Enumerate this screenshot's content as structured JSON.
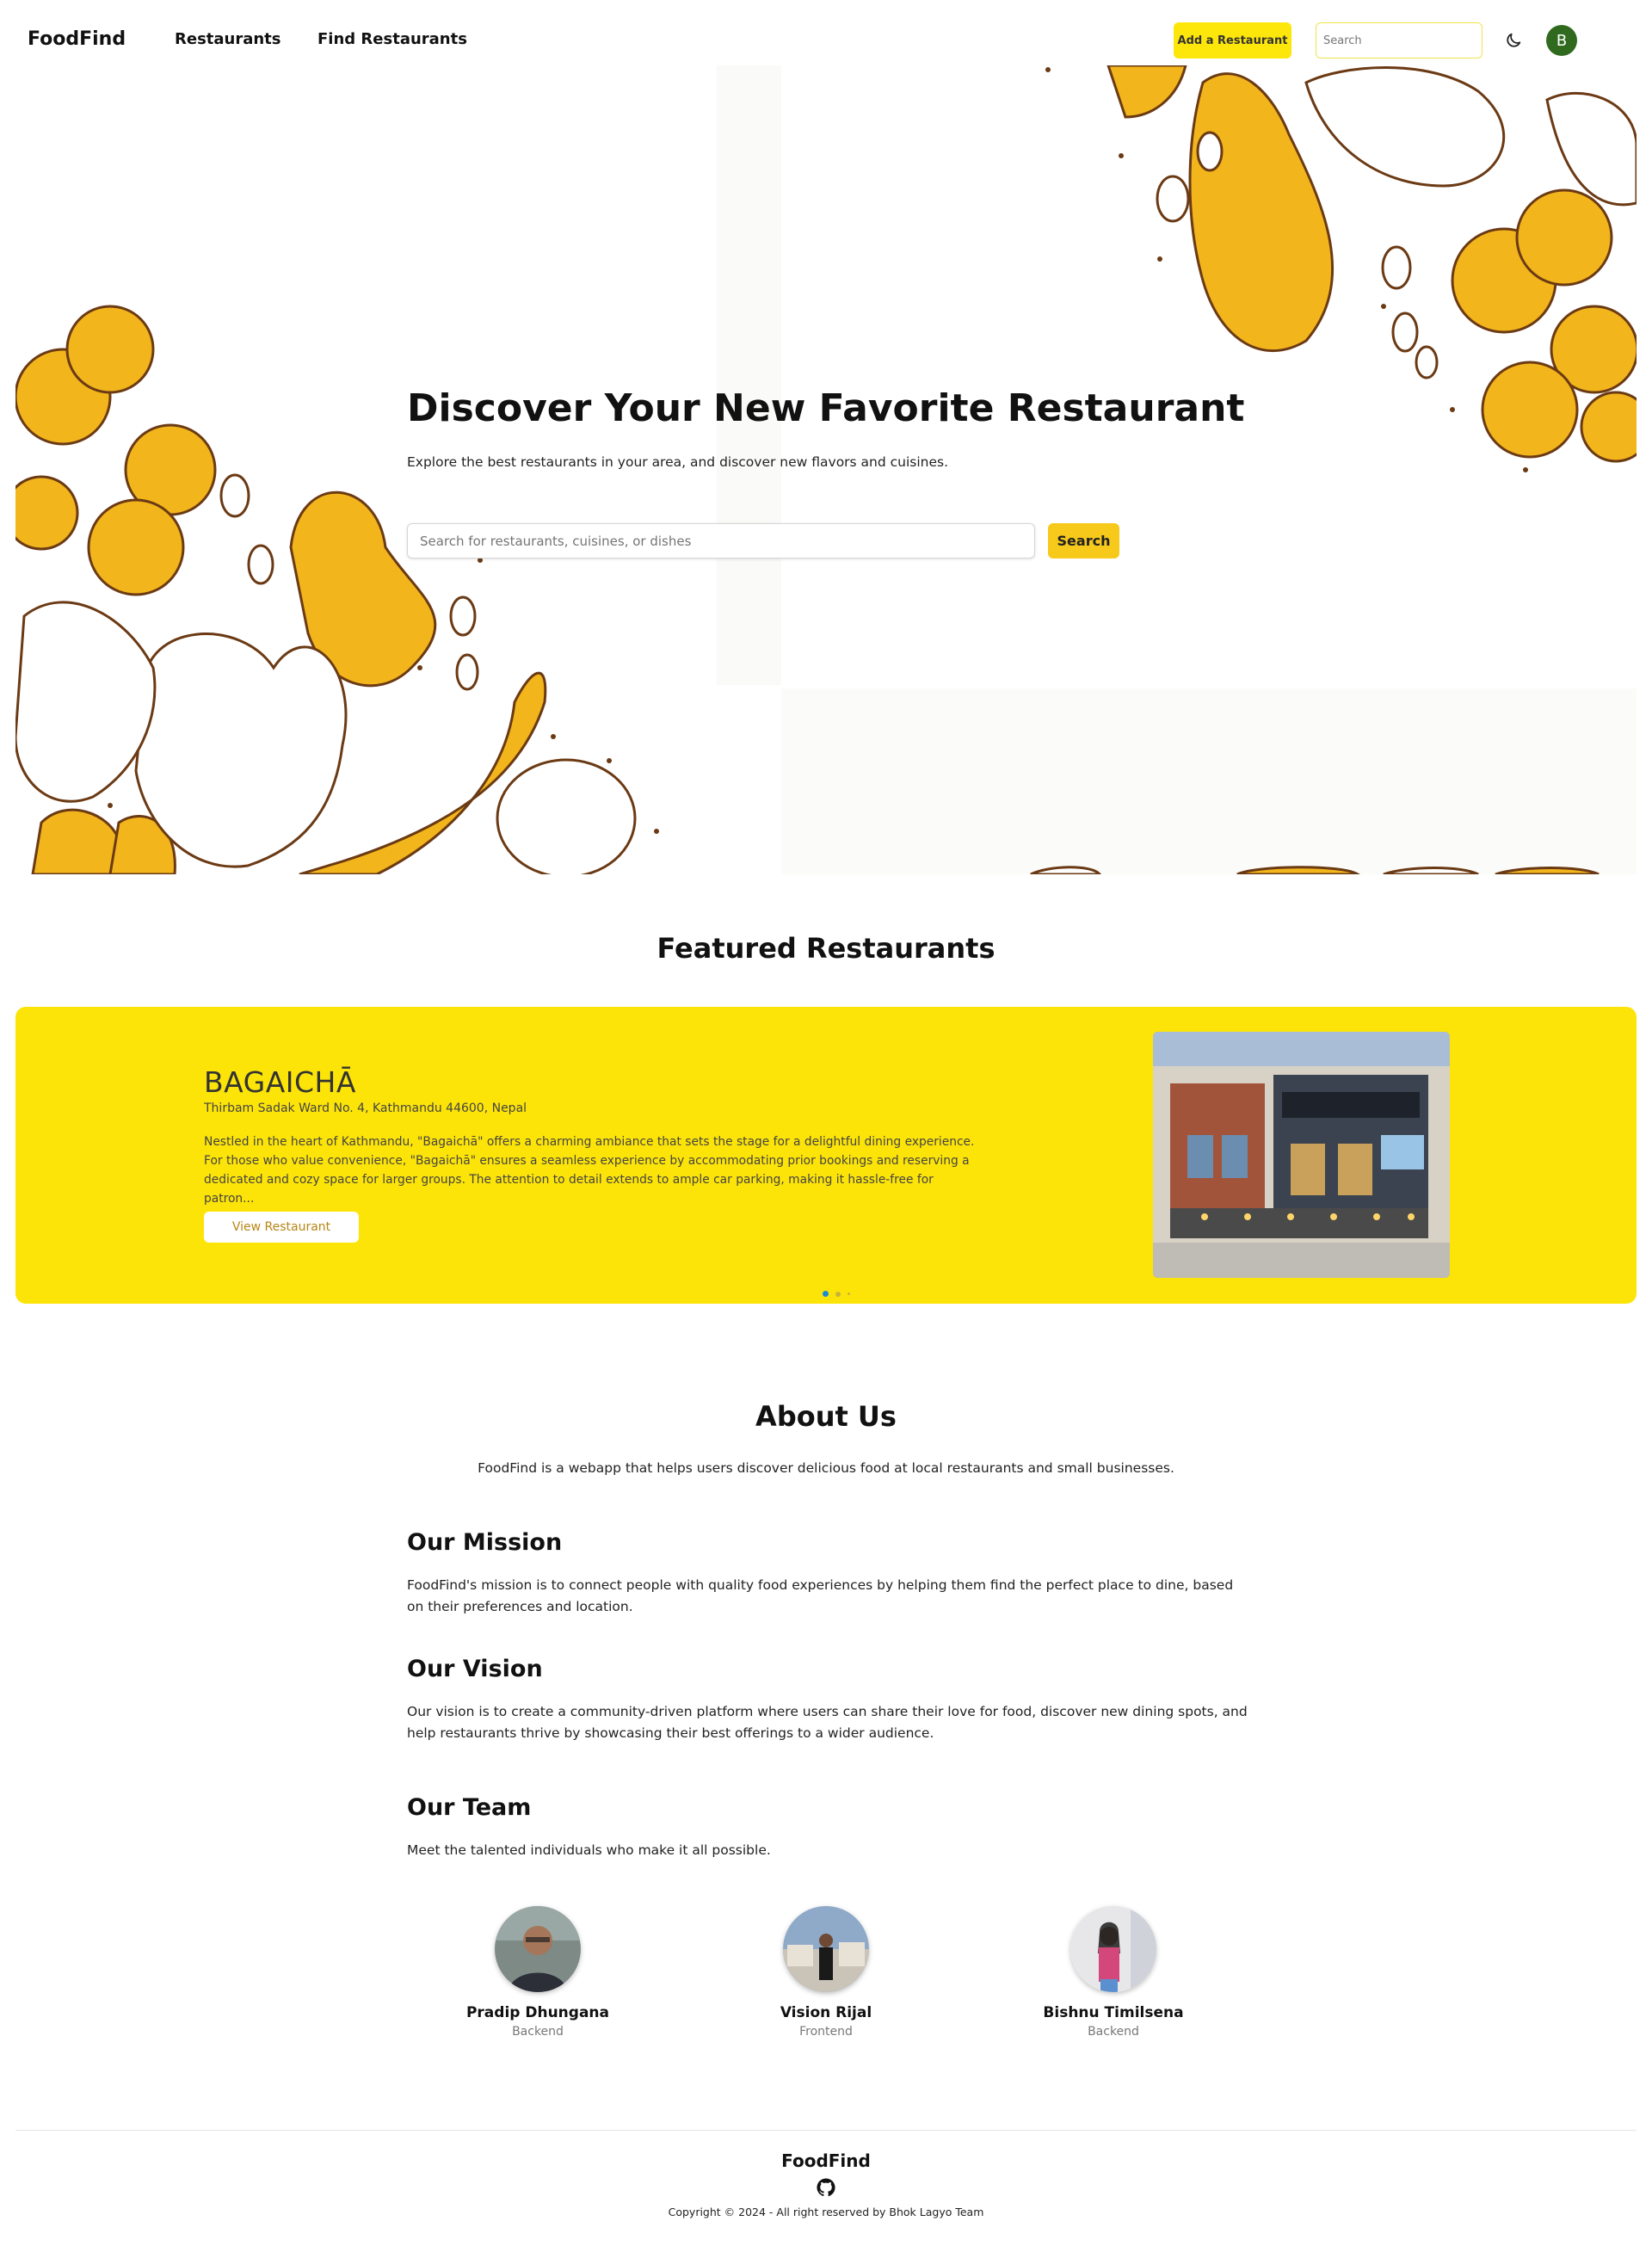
{
  "nav": {
    "brand": "FoodFind",
    "links": [
      "Restaurants",
      "Find Restaurants"
    ],
    "add_button": "Add a Restaurant",
    "search_placeholder": "Search",
    "theme_icon": "moon-icon",
    "avatar_initial": "B",
    "avatar_color": "#2f6a1e"
  },
  "hero": {
    "title": "Discover Your New Favorite Restaurant",
    "subtitle": "Explore the best restaurants in your area, and discover new flavors and cuisines.",
    "search_placeholder": "Search for restaurants, cuisines, or dishes",
    "search_button": "Search"
  },
  "featured": {
    "title": "Featured Restaurants",
    "restaurant": {
      "name": "BAGAICHĀ",
      "address": "Thirbam Sadak Ward No. 4, Kathmandu 44600, Nepal",
      "description": "Nestled in the heart of Kathmandu, \"Bagaichā\" offers a charming ambiance that sets the stage for a delightful dining experience. For those who value convenience, \"Bagaichā\" ensures a seamless experience by accommodating prior bookings and reserving a dedicated and cozy space for larger groups. The attention to detail extends to ample car parking, making it hassle-free for patron...",
      "button": "View Restaurant"
    },
    "slides_total": 3,
    "active_slide": 1,
    "accent": "#fde408"
  },
  "about": {
    "title": "About Us",
    "lead": "FoodFind is a webapp that helps users discover delicious food at local restaurants and small businesses.",
    "mission_title": "Our Mission",
    "mission_text": "FoodFind's mission is to connect people with quality food experiences by helping them find the perfect place to dine, based on their preferences and location.",
    "vision_title": "Our Vision",
    "vision_text": "Our vision is to create a community-driven platform where users can share their love for food, discover new dining spots, and help restaurants thrive by showcasing their best offerings to a wider audience.",
    "team_title": "Our Team",
    "team_text": "Meet the talented individuals who make it all possible.",
    "team": [
      {
        "name": "Pradip Dhungana",
        "role": "Backend"
      },
      {
        "name": "Vision Rijal",
        "role": "Frontend"
      },
      {
        "name": "Bishnu Timilsena",
        "role": "Backend"
      }
    ]
  },
  "footer": {
    "brand": "FoodFind",
    "icon": "github-icon",
    "copyright": "Copyright © 2024 - All right reserved by Bhok Lagyo Team"
  }
}
